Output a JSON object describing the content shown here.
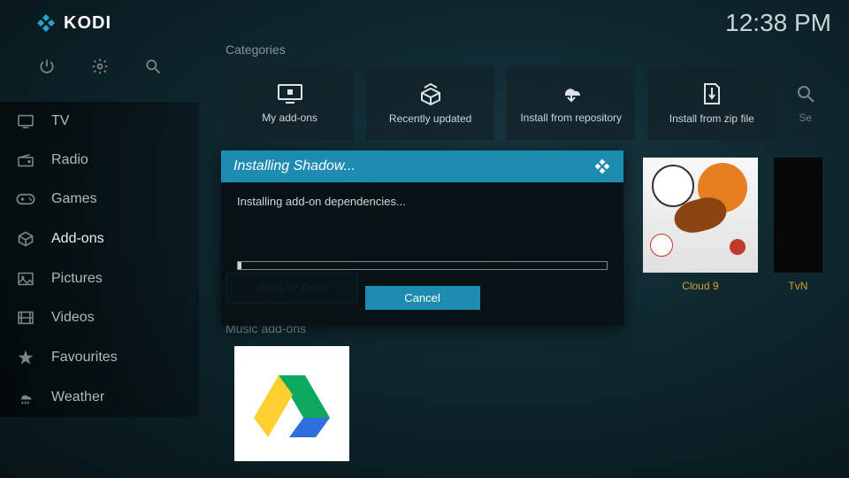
{
  "app": {
    "name": "KODI"
  },
  "clock": "12:38 PM",
  "sys_icons": {
    "power": "power",
    "settings": "settings",
    "search": "search"
  },
  "sidebar": [
    {
      "label": "TV",
      "icon": "tv"
    },
    {
      "label": "Radio",
      "icon": "radio"
    },
    {
      "label": "Games",
      "icon": "games"
    },
    {
      "label": "Add-ons",
      "icon": "addons",
      "active": true
    },
    {
      "label": "Pictures",
      "icon": "pictures"
    },
    {
      "label": "Videos",
      "icon": "videos"
    },
    {
      "label": "Favourites",
      "icon": "favourites"
    },
    {
      "label": "Weather",
      "icon": "weather"
    }
  ],
  "sections": {
    "categories_label": "Categories",
    "categories": [
      {
        "label": "My add-ons"
      },
      {
        "label": "Recently updated"
      },
      {
        "label": "Install from repository"
      },
      {
        "label": "Install from zip file"
      },
      {
        "label": "Se"
      }
    ],
    "video_addons": [
      {
        "label": "Odds N' Ends",
        "selected": true
      },
      {
        "label": ""
      },
      {
        "label": ""
      },
      {
        "label": "Cloud 9"
      },
      {
        "label": "TvN"
      }
    ],
    "music_label": "Music add-ons"
  },
  "dialog": {
    "title": "Installing Shadow...",
    "message": "Installing add-on dependencies...",
    "progress_pct": 1,
    "cancel": "Cancel"
  }
}
